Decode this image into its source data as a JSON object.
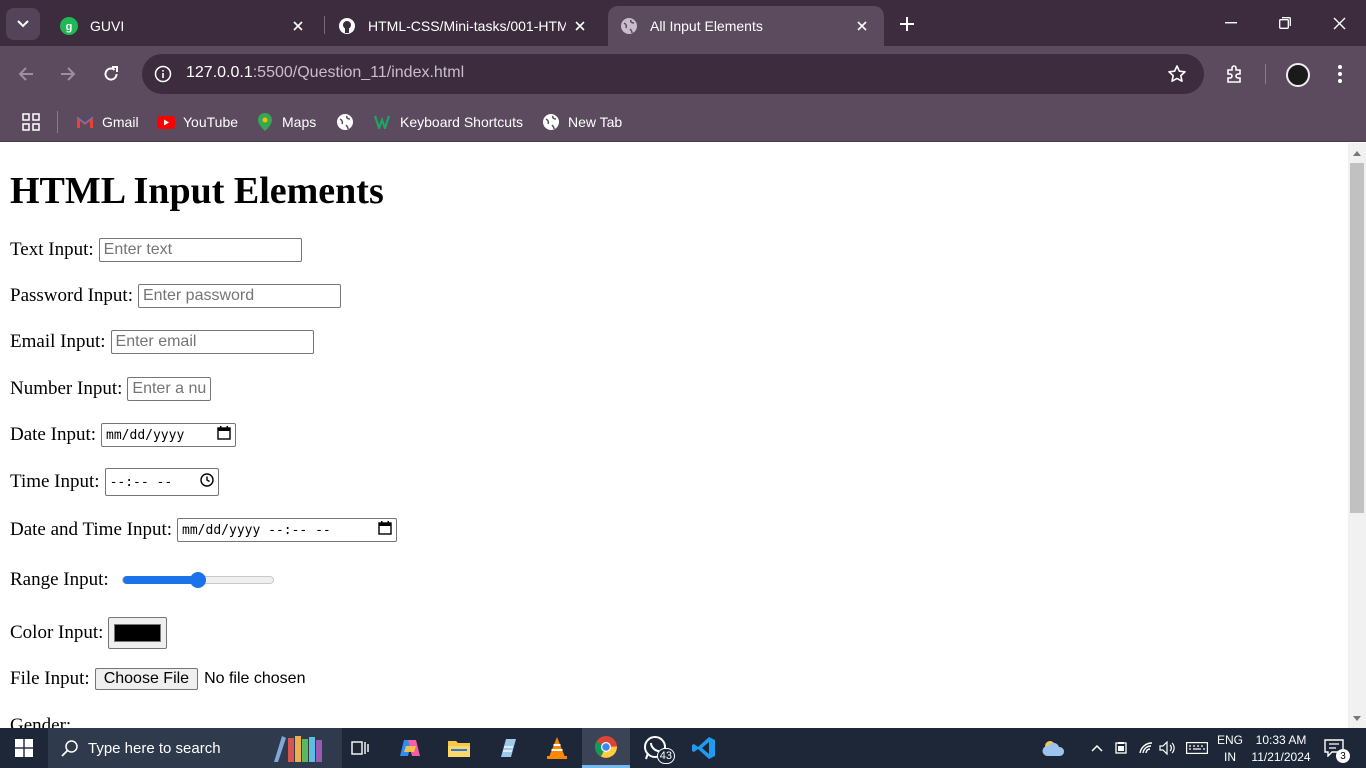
{
  "browser": {
    "tabs": [
      {
        "title": "GUVI",
        "icon": "guvi-icon",
        "active": false
      },
      {
        "title": "HTML-CSS/Mini-tasks/001-HTM",
        "icon": "github-icon",
        "active": false
      },
      {
        "title": "All Input Elements",
        "icon": "globe-icon",
        "active": true
      }
    ],
    "address": {
      "host": "127.0.0.1",
      "path": ":5500/Question_11/index.html"
    },
    "bookmarks": [
      {
        "label": "Gmail",
        "icon": "gmail-icon"
      },
      {
        "label": "YouTube",
        "icon": "youtube-icon"
      },
      {
        "label": "Maps",
        "icon": "maps-icon"
      },
      {
        "label": "",
        "icon": "globe-icon"
      },
      {
        "label": "Keyboard Shortcuts",
        "icon": "keyboard-shortcuts-icon"
      },
      {
        "label": "New Tab",
        "icon": "globe-icon"
      }
    ]
  },
  "page": {
    "heading": "HTML Input Elements",
    "text_input": {
      "label": "Text Input:",
      "placeholder": "Enter text"
    },
    "password_input": {
      "label": "Password Input:",
      "placeholder": "Enter password"
    },
    "email_input": {
      "label": "Email Input:",
      "placeholder": "Enter email"
    },
    "number_input": {
      "label": "Number Input:",
      "placeholder": "Enter a number"
    },
    "date_input": {
      "label": "Date Input:",
      "value": "mm/dd/yyyy"
    },
    "time_input": {
      "label": "Time Input:",
      "value": "--:-- --"
    },
    "datetime_input": {
      "label": "Date and Time Input:",
      "value": "mm/dd/yyyy --:-- --"
    },
    "range_input": {
      "label": "Range Input:",
      "value_fraction": 0.5
    },
    "color_input": {
      "label": "Color Input:",
      "value": "#000000"
    },
    "file_input": {
      "label": "File Input:",
      "button": "Choose File",
      "status": "No file chosen"
    },
    "gender": {
      "label": "Gender:"
    }
  },
  "taskbar": {
    "search_placeholder": "Type here to search",
    "whatsapp_badge": "43",
    "language": "ENG",
    "region": "IN",
    "time": "10:33 AM",
    "date": "11/21/2024",
    "notification_count": "3"
  },
  "colors": {
    "chrome_dark": "#3c2c3e",
    "chrome_mid": "#5c4a5e",
    "accent_blue": "#1a73e8",
    "taskbar": "#1d2738"
  }
}
